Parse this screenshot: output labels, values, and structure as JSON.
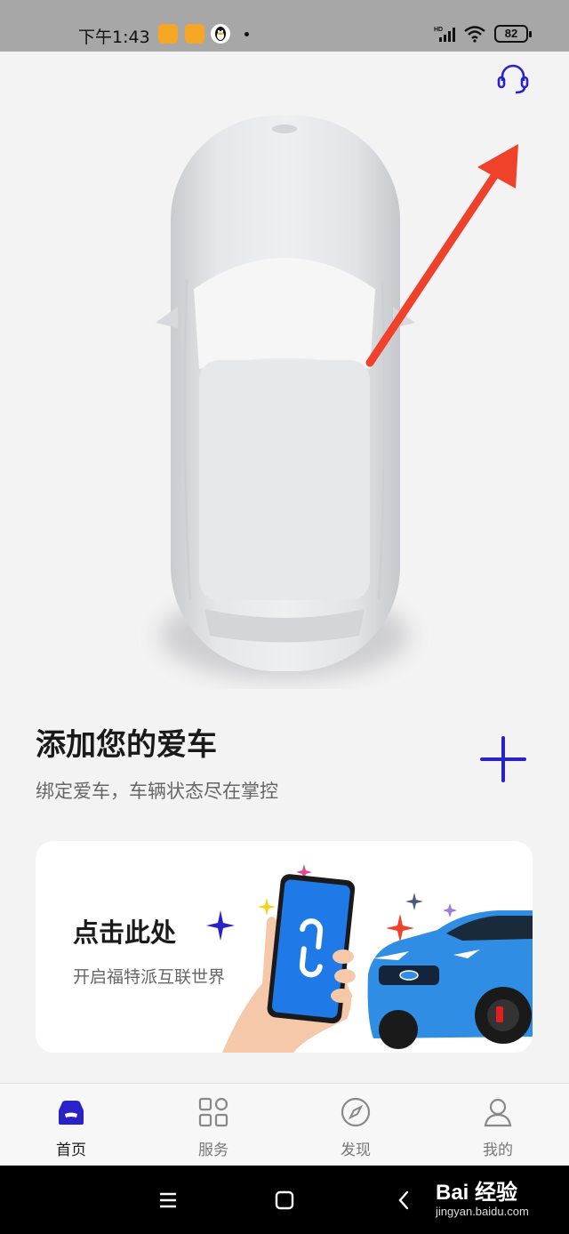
{
  "status_bar": {
    "time": "下午1:43",
    "battery": "82",
    "network_badge": "HD"
  },
  "header": {
    "support_icon": "headset-icon"
  },
  "add_car": {
    "title": "添加您的爱车",
    "subtitle": "绑定爱车，车辆状态尽在掌控",
    "add_icon": "plus-icon"
  },
  "promo_card": {
    "title": "点击此处",
    "subtitle": "开启福特派互联世界"
  },
  "tabs": [
    {
      "label": "首页",
      "icon": "car-icon",
      "active": true
    },
    {
      "label": "服务",
      "icon": "grid-icon",
      "active": false
    },
    {
      "label": "发现",
      "icon": "compass-icon",
      "active": false
    },
    {
      "label": "我的",
      "icon": "user-icon",
      "active": false
    }
  ],
  "nav": {
    "watermark_main": "Bai 经验",
    "watermark_sub": "jingyan.baidu.com"
  },
  "colors": {
    "accent": "#2a22c9",
    "arrow": "#f0412a",
    "card_car": "#2f8de4"
  }
}
